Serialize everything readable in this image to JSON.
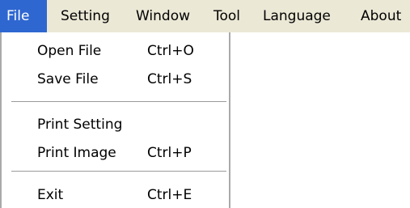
{
  "menubar": {
    "items": [
      {
        "label": "File"
      },
      {
        "label": "Setting"
      },
      {
        "label": "Window"
      },
      {
        "label": "Tool"
      },
      {
        "label": "Language"
      },
      {
        "label": "About"
      }
    ]
  },
  "file_menu": {
    "items": [
      {
        "label": "Open File",
        "shortcut": "Ctrl+O"
      },
      {
        "label": "Save File",
        "shortcut": "Ctrl+S"
      },
      {
        "label": "Print Setting",
        "shortcut": ""
      },
      {
        "label": "Print Image",
        "shortcut": "Ctrl+P"
      },
      {
        "label": "Exit",
        "shortcut": "Ctrl+E"
      }
    ]
  },
  "colors": {
    "menubar_bg": "#ebe8d6",
    "highlight": "#2f67d1"
  }
}
